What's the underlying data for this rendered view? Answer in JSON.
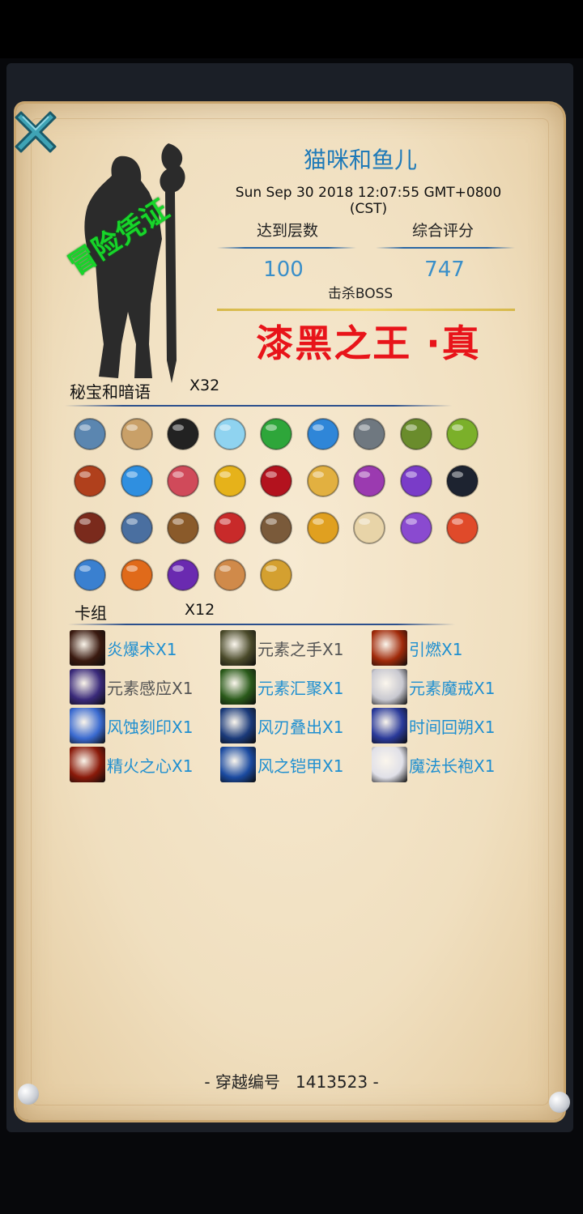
{
  "header": {
    "player_name": "猫咪和鱼儿",
    "timestamp": "Sun Sep 30 2018 12:07:55 GMT+0800 (CST)",
    "stamp_text": "冒险凭证"
  },
  "stats": {
    "floor_label": "达到层数",
    "floor_value": "100",
    "score_label": "综合评分",
    "score_value": "747",
    "boss_label": "击杀BOSS",
    "boss_name": "漆黑之王 ·真"
  },
  "treasures": {
    "title": "秘宝和暗语",
    "count": "X32",
    "items": [
      {
        "icon": "armor-icon",
        "color": "#5b86b0"
      },
      {
        "icon": "scroll-icon",
        "color": "#c9a068"
      },
      {
        "icon": "trinity-knot-icon",
        "color": "#222222"
      },
      {
        "icon": "crescent-moon-icon",
        "color": "#8fd3f0"
      },
      {
        "icon": "green-rune-icon",
        "color": "#2ea63a"
      },
      {
        "icon": "blue-rune-icon",
        "color": "#2f86d8"
      },
      {
        "icon": "anchor-icon",
        "color": "#6f7880"
      },
      {
        "icon": "zongzi-icon",
        "color": "#6a8c2c"
      },
      {
        "icon": "green-beans-icon",
        "color": "#7bb02a"
      },
      {
        "icon": "fire-stone-icon",
        "color": "#b0401c"
      },
      {
        "icon": "blue-spiral-rune-icon",
        "color": "#2f8fe0"
      },
      {
        "icon": "red-scroll-icon",
        "color": "#d04a5a"
      },
      {
        "icon": "golden-egg-icon",
        "color": "#e6b21a"
      },
      {
        "icon": "rose-icon",
        "color": "#b3121e"
      },
      {
        "icon": "golden-card-icon",
        "color": "#e2b040"
      },
      {
        "icon": "eye-ring-icon",
        "color": "#9b3ab0"
      },
      {
        "icon": "purple-flame-rune-icon",
        "color": "#7a3cc8"
      },
      {
        "icon": "black-beetle-icon",
        "color": "#1d2330"
      },
      {
        "icon": "chain-icon",
        "color": "#7a2a1c"
      },
      {
        "icon": "spiked-shield-icon",
        "color": "#4a6fa0"
      },
      {
        "icon": "shovel-icon",
        "color": "#8a5a2a"
      },
      {
        "icon": "christmas-stocking-icon",
        "color": "#c82a2a"
      },
      {
        "icon": "money-bag-icon",
        "color": "#7a5a3a"
      },
      {
        "icon": "golden-cup-icon",
        "color": "#e0a020"
      },
      {
        "icon": "bandage-icon",
        "color": "#e8d4a8"
      },
      {
        "icon": "purple-feather-icon",
        "color": "#8a4ad0"
      },
      {
        "icon": "red-spiral-card-icon",
        "color": "#e04a2a"
      },
      {
        "icon": "blue-hook-icon",
        "color": "#3a80d0"
      },
      {
        "icon": "fire-medallion-icon",
        "color": "#e06a1a"
      },
      {
        "icon": "purple-vortex-icon",
        "color": "#6a2ab0"
      },
      {
        "icon": "potion-tube-icon",
        "color": "#d08a4a"
      },
      {
        "icon": "rocking-horse-icon",
        "color": "#d4a030"
      }
    ]
  },
  "deck": {
    "title": "卡组",
    "count": "X12",
    "cards": [
      {
        "label": "炎爆术X1",
        "color": "#1f8fd0",
        "icon": "fireball-vortex-icon",
        "icon_color": "#3a1a10"
      },
      {
        "label": "元素之手X1",
        "color": "#555555",
        "icon": "element-hand-icon",
        "icon_color": "#4a4a2a"
      },
      {
        "label": "引燃X1",
        "color": "#1f8fd0",
        "icon": "ignite-icon",
        "icon_color": "#a02a0a"
      },
      {
        "label": "元素感应X1",
        "color": "#555555",
        "icon": "element-sense-icon",
        "icon_color": "#3a2a7a"
      },
      {
        "label": "元素汇聚X1",
        "color": "#1f8fd0",
        "icon": "element-gather-icon",
        "icon_color": "#2a5a1a"
      },
      {
        "label": "元素魔戒X1",
        "color": "#1f8fd0",
        "icon": "magic-ring-icon",
        "icon_color": "#c8c8d0"
      },
      {
        "label": "风蚀刻印X1",
        "color": "#1f8fd0",
        "icon": "wind-mark-icon",
        "icon_color": "#3a6ad0"
      },
      {
        "label": "风刃叠出X1",
        "color": "#1f8fd0",
        "icon": "wind-blade-icon",
        "icon_color": "#1a3a7a"
      },
      {
        "label": "时间回朔X1",
        "color": "#1f8fd0",
        "icon": "time-rewind-icon",
        "icon_color": "#2a3a9a"
      },
      {
        "label": "精火之心X1",
        "color": "#1f8fd0",
        "icon": "fire-heart-icon",
        "icon_color": "#8a1a0a"
      },
      {
        "label": "风之铠甲X1",
        "color": "#1f8fd0",
        "icon": "wind-armor-icon",
        "icon_color": "#1a4aa0"
      },
      {
        "label": "魔法长袍X1",
        "color": "#1f8fd0",
        "icon": "magic-robe-icon",
        "icon_color": "#e0e0e8"
      }
    ]
  },
  "footer": {
    "transfer_label": "- 穿越编号",
    "transfer_id": "1413523",
    "transfer_suffix": "-"
  }
}
